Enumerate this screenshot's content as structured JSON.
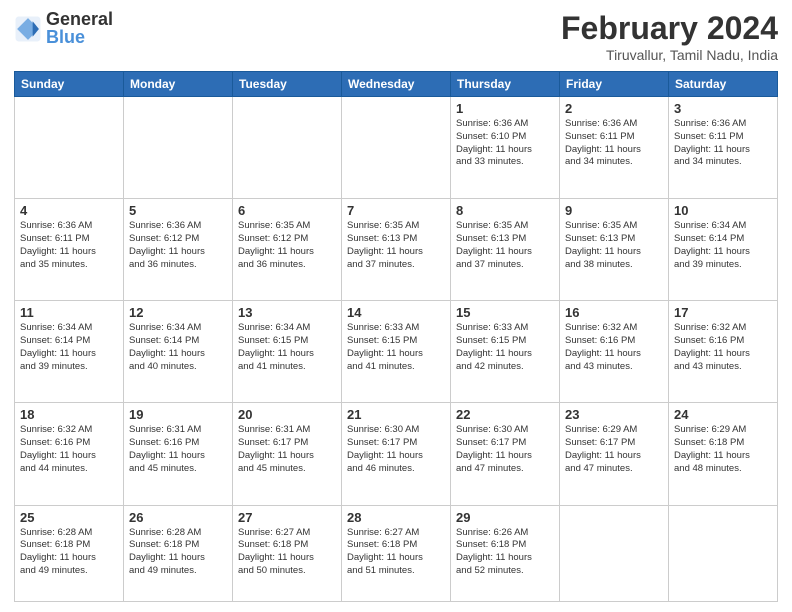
{
  "header": {
    "logo_line1": "General",
    "logo_line2": "Blue",
    "month_title": "February 2024",
    "location": "Tiruvallur, Tamil Nadu, India"
  },
  "days_of_week": [
    "Sunday",
    "Monday",
    "Tuesday",
    "Wednesday",
    "Thursday",
    "Friday",
    "Saturday"
  ],
  "weeks": [
    [
      {
        "day": "",
        "info": ""
      },
      {
        "day": "",
        "info": ""
      },
      {
        "day": "",
        "info": ""
      },
      {
        "day": "",
        "info": ""
      },
      {
        "day": "1",
        "info": "Sunrise: 6:36 AM\nSunset: 6:10 PM\nDaylight: 11 hours\nand 33 minutes."
      },
      {
        "day": "2",
        "info": "Sunrise: 6:36 AM\nSunset: 6:11 PM\nDaylight: 11 hours\nand 34 minutes."
      },
      {
        "day": "3",
        "info": "Sunrise: 6:36 AM\nSunset: 6:11 PM\nDaylight: 11 hours\nand 34 minutes."
      }
    ],
    [
      {
        "day": "4",
        "info": "Sunrise: 6:36 AM\nSunset: 6:11 PM\nDaylight: 11 hours\nand 35 minutes."
      },
      {
        "day": "5",
        "info": "Sunrise: 6:36 AM\nSunset: 6:12 PM\nDaylight: 11 hours\nand 36 minutes."
      },
      {
        "day": "6",
        "info": "Sunrise: 6:35 AM\nSunset: 6:12 PM\nDaylight: 11 hours\nand 36 minutes."
      },
      {
        "day": "7",
        "info": "Sunrise: 6:35 AM\nSunset: 6:13 PM\nDaylight: 11 hours\nand 37 minutes."
      },
      {
        "day": "8",
        "info": "Sunrise: 6:35 AM\nSunset: 6:13 PM\nDaylight: 11 hours\nand 37 minutes."
      },
      {
        "day": "9",
        "info": "Sunrise: 6:35 AM\nSunset: 6:13 PM\nDaylight: 11 hours\nand 38 minutes."
      },
      {
        "day": "10",
        "info": "Sunrise: 6:34 AM\nSunset: 6:14 PM\nDaylight: 11 hours\nand 39 minutes."
      }
    ],
    [
      {
        "day": "11",
        "info": "Sunrise: 6:34 AM\nSunset: 6:14 PM\nDaylight: 11 hours\nand 39 minutes."
      },
      {
        "day": "12",
        "info": "Sunrise: 6:34 AM\nSunset: 6:14 PM\nDaylight: 11 hours\nand 40 minutes."
      },
      {
        "day": "13",
        "info": "Sunrise: 6:34 AM\nSunset: 6:15 PM\nDaylight: 11 hours\nand 41 minutes."
      },
      {
        "day": "14",
        "info": "Sunrise: 6:33 AM\nSunset: 6:15 PM\nDaylight: 11 hours\nand 41 minutes."
      },
      {
        "day": "15",
        "info": "Sunrise: 6:33 AM\nSunset: 6:15 PM\nDaylight: 11 hours\nand 42 minutes."
      },
      {
        "day": "16",
        "info": "Sunrise: 6:32 AM\nSunset: 6:16 PM\nDaylight: 11 hours\nand 43 minutes."
      },
      {
        "day": "17",
        "info": "Sunrise: 6:32 AM\nSunset: 6:16 PM\nDaylight: 11 hours\nand 43 minutes."
      }
    ],
    [
      {
        "day": "18",
        "info": "Sunrise: 6:32 AM\nSunset: 6:16 PM\nDaylight: 11 hours\nand 44 minutes."
      },
      {
        "day": "19",
        "info": "Sunrise: 6:31 AM\nSunset: 6:16 PM\nDaylight: 11 hours\nand 45 minutes."
      },
      {
        "day": "20",
        "info": "Sunrise: 6:31 AM\nSunset: 6:17 PM\nDaylight: 11 hours\nand 45 minutes."
      },
      {
        "day": "21",
        "info": "Sunrise: 6:30 AM\nSunset: 6:17 PM\nDaylight: 11 hours\nand 46 minutes."
      },
      {
        "day": "22",
        "info": "Sunrise: 6:30 AM\nSunset: 6:17 PM\nDaylight: 11 hours\nand 47 minutes."
      },
      {
        "day": "23",
        "info": "Sunrise: 6:29 AM\nSunset: 6:17 PM\nDaylight: 11 hours\nand 47 minutes."
      },
      {
        "day": "24",
        "info": "Sunrise: 6:29 AM\nSunset: 6:18 PM\nDaylight: 11 hours\nand 48 minutes."
      }
    ],
    [
      {
        "day": "25",
        "info": "Sunrise: 6:28 AM\nSunset: 6:18 PM\nDaylight: 11 hours\nand 49 minutes."
      },
      {
        "day": "26",
        "info": "Sunrise: 6:28 AM\nSunset: 6:18 PM\nDaylight: 11 hours\nand 49 minutes."
      },
      {
        "day": "27",
        "info": "Sunrise: 6:27 AM\nSunset: 6:18 PM\nDaylight: 11 hours\nand 50 minutes."
      },
      {
        "day": "28",
        "info": "Sunrise: 6:27 AM\nSunset: 6:18 PM\nDaylight: 11 hours\nand 51 minutes."
      },
      {
        "day": "29",
        "info": "Sunrise: 6:26 AM\nSunset: 6:18 PM\nDaylight: 11 hours\nand 52 minutes."
      },
      {
        "day": "",
        "info": ""
      },
      {
        "day": "",
        "info": ""
      }
    ]
  ]
}
